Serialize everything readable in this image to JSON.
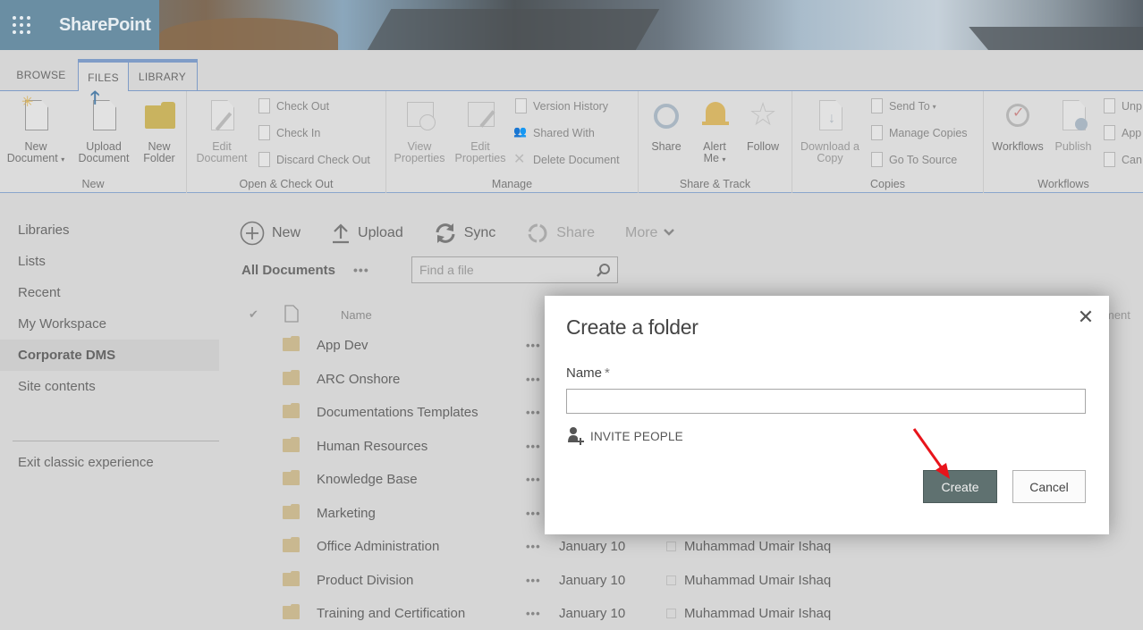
{
  "header": {
    "app_title": "SharePoint",
    "waffle_icon": "app-launcher-icon"
  },
  "ribbon": {
    "tabs": [
      {
        "label": "BROWSE",
        "active": false
      },
      {
        "label": "FILES",
        "active": true
      },
      {
        "label": "LIBRARY",
        "active": false
      }
    ],
    "groups": {
      "new": {
        "label": "New",
        "new_document": "New\nDocument",
        "new_document_l1": "New",
        "new_document_l2": "Document",
        "upload_l1": "Upload",
        "upload_l2": "Document",
        "folder_l1": "New",
        "folder_l2": "Folder"
      },
      "open": {
        "label": "Open & Check Out",
        "edit_l1": "Edit",
        "edit_l2": "Document",
        "check_out": "Check Out",
        "check_in": "Check In",
        "discard": "Discard Check Out"
      },
      "manage": {
        "label": "Manage",
        "view_l1": "View",
        "view_l2": "Properties",
        "edit_l1": "Edit",
        "edit_l2": "Properties",
        "version_history": "Version History",
        "shared_with": "Shared With",
        "delete_document": "Delete Document"
      },
      "share": {
        "label": "Share & Track",
        "share": "Share",
        "alert_l1": "Alert",
        "alert_l2": "Me",
        "follow": "Follow"
      },
      "copies": {
        "label": "Copies",
        "download_l1": "Download a",
        "download_l2": "Copy",
        "send_to": "Send To",
        "manage_copies": "Manage Copies",
        "go_to_source": "Go To Source"
      },
      "workflows": {
        "label": "Workflows",
        "workflows": "Workflows",
        "publish": "Publish",
        "unpublish": "Unp",
        "approve": "App",
        "cancel": "Can"
      }
    }
  },
  "sidebar": {
    "items": [
      {
        "label": "Libraries",
        "active": false
      },
      {
        "label": "Lists",
        "active": false
      },
      {
        "label": "Recent",
        "active": false
      },
      {
        "label": "My Workspace",
        "active": false
      },
      {
        "label": "Corporate DMS",
        "active": true
      },
      {
        "label": "Site contents",
        "active": false
      }
    ],
    "exit_classic": "Exit classic experience"
  },
  "commandbar": {
    "new": "New",
    "upload": "Upload",
    "sync": "Sync",
    "share": "Share",
    "more": "More"
  },
  "view": {
    "name": "All Documents",
    "more_dots": "•••",
    "search_placeholder": "Find a file"
  },
  "list": {
    "columns": {
      "name": "Name",
      "modified_by_partial": "ment"
    },
    "rows": [
      {
        "name": "App Dev",
        "modified": "",
        "modified_by": ""
      },
      {
        "name": "ARC Onshore",
        "modified": "",
        "modified_by": ""
      },
      {
        "name": "Documentations Templates",
        "modified": "",
        "modified_by": ""
      },
      {
        "name": "Human Resources",
        "modified": "",
        "modified_by": ""
      },
      {
        "name": "Knowledge Base",
        "modified": "",
        "modified_by": ""
      },
      {
        "name": "Marketing",
        "modified": "",
        "modified_by": ""
      },
      {
        "name": "Office Administration",
        "modified": "January 10",
        "modified_by": "Muhammad Umair Ishaq"
      },
      {
        "name": "Product Division",
        "modified": "January 10",
        "modified_by": "Muhammad Umair Ishaq"
      },
      {
        "name": "Training and Certification",
        "modified": "January 10",
        "modified_by": "Muhammad Umair Ishaq"
      }
    ],
    "row_dots": "•••"
  },
  "dialog": {
    "title": "Create a folder",
    "name_label": "Name",
    "required_mark": "*",
    "name_value": "",
    "invite_people": "INVITE PEOPLE",
    "create_label": "Create",
    "cancel_label": "Cancel",
    "close_glyph": "✕"
  },
  "colors": {
    "ribbon_accent": "#7f9cc7",
    "folder": "#c9b890",
    "create_button": "#5f7170",
    "annotation_arrow": "#e8141b"
  }
}
